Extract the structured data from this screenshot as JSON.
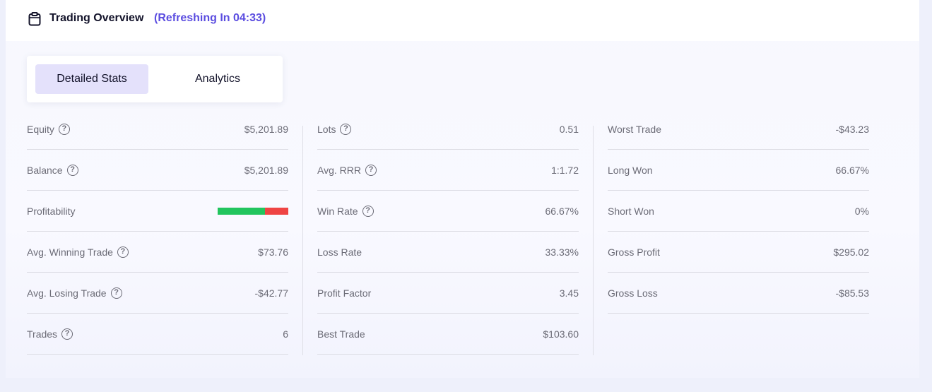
{
  "header": {
    "title": "Trading Overview",
    "refresh": "(Refreshing In 04:33)",
    "icon": "clipboard-icon"
  },
  "tabs": [
    {
      "label": "Detailed Stats",
      "active": true
    },
    {
      "label": "Analytics",
      "active": false
    }
  ],
  "colors": {
    "win": "#22c55e",
    "loss": "#ef4444",
    "accent": "#5b4de0"
  },
  "stats": {
    "col1": [
      {
        "label": "Equity",
        "value": "$5,201.89",
        "help": true
      },
      {
        "label": "Balance",
        "value": "$5,201.89",
        "help": true
      },
      {
        "label": "Profitability",
        "value": "",
        "win_fraction": 0.6667,
        "loss_fraction": 0.3333
      },
      {
        "label": "Avg. Winning Trade",
        "value": "$73.76",
        "help": true
      },
      {
        "label": "Avg. Losing Trade",
        "value": "-$42.77",
        "help": true
      },
      {
        "label": "Trades",
        "value": "6",
        "help": true
      }
    ],
    "col2": [
      {
        "label": "Lots",
        "value": "0.51",
        "help": true
      },
      {
        "label": "Avg. RRR",
        "value": "1:1.72",
        "help": true
      },
      {
        "label": "Win Rate",
        "value": "66.67%",
        "help": true
      },
      {
        "label": "Loss Rate",
        "value": "33.33%"
      },
      {
        "label": "Profit Factor",
        "value": "3.45"
      },
      {
        "label": "Best Trade",
        "value": "$103.60"
      }
    ],
    "col3": [
      {
        "label": "Worst Trade",
        "value": "-$43.23"
      },
      {
        "label": "Long Won",
        "value": "66.67%"
      },
      {
        "label": "Short Won",
        "value": "0%"
      },
      {
        "label": "Gross Profit",
        "value": "$295.02"
      },
      {
        "label": "Gross Loss",
        "value": "-$85.53"
      }
    ]
  }
}
